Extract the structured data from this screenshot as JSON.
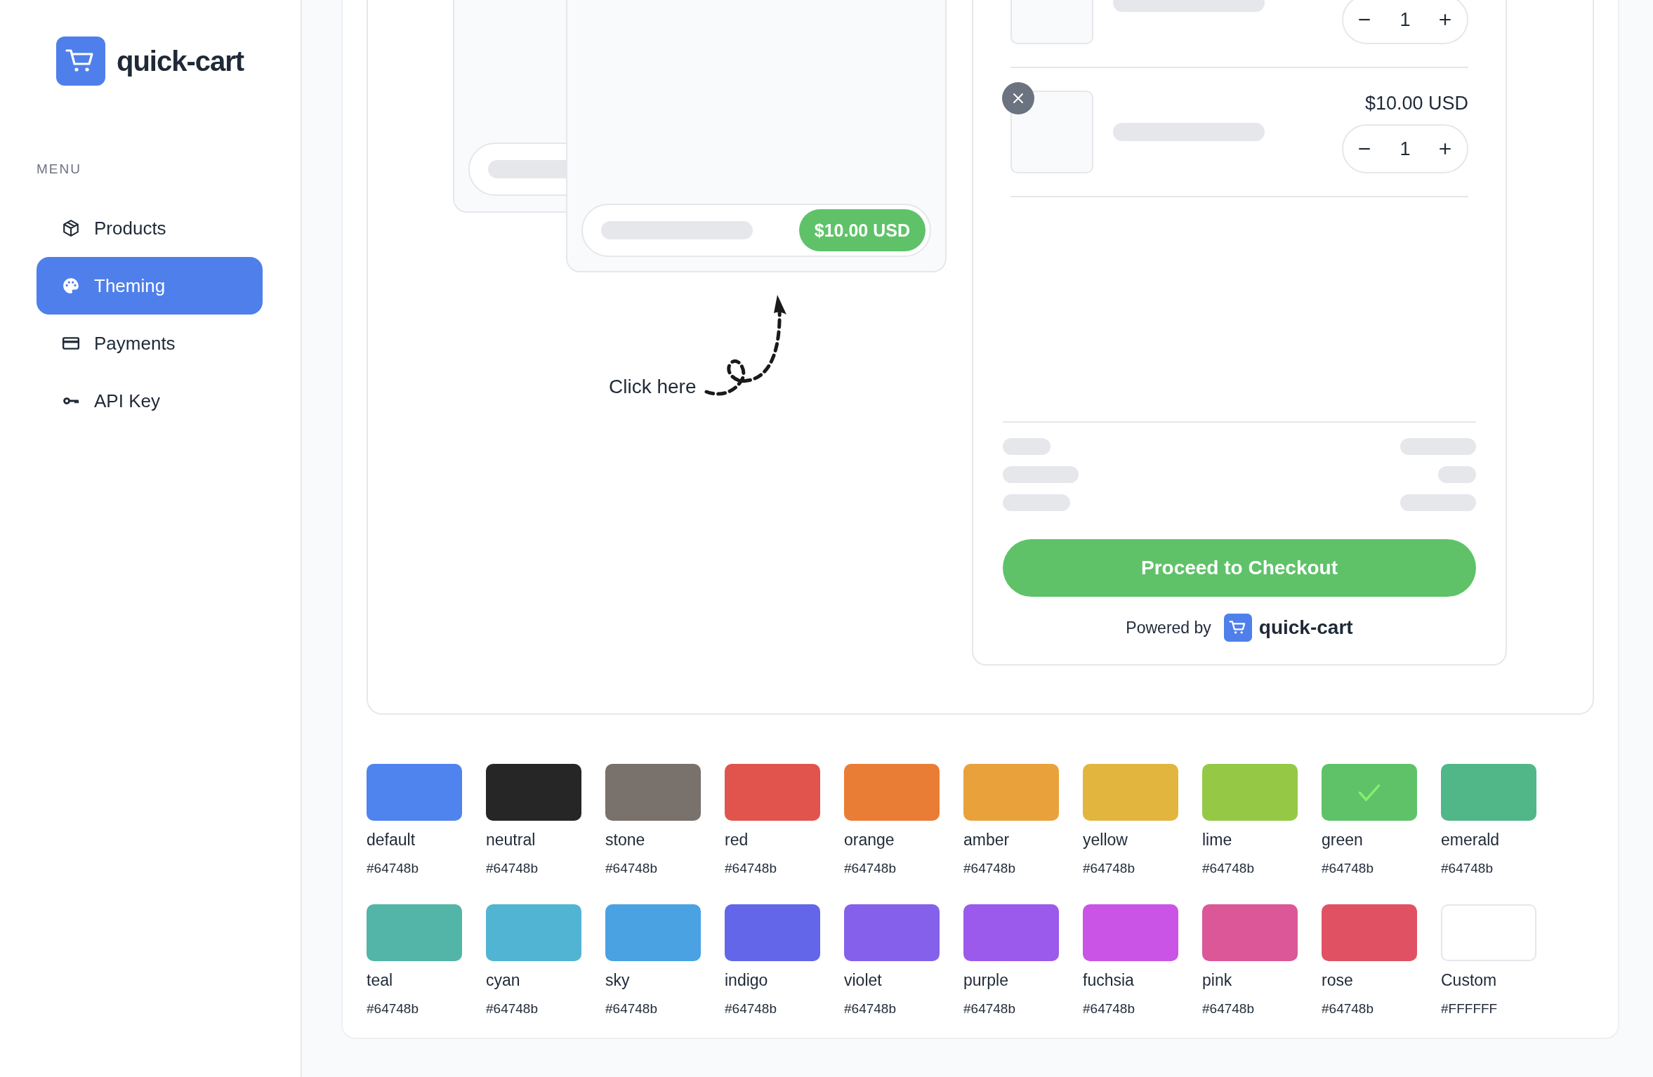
{
  "brand": {
    "name": "quick-cart"
  },
  "menu": {
    "label": "MENU",
    "items": [
      {
        "label": "Products",
        "kind": "box",
        "selected": false
      },
      {
        "label": "Theming",
        "kind": "palette",
        "selected": true
      },
      {
        "label": "Payments",
        "kind": "card",
        "selected": false
      },
      {
        "label": "API Key",
        "kind": "key",
        "selected": false
      }
    ]
  },
  "preview": {
    "product_price": "$10.00 USD",
    "hint": "Click here",
    "cart": {
      "items": [
        {
          "quantity": "1",
          "removable": false
        },
        {
          "price": "$10.00 USD",
          "quantity": "1",
          "removable": true
        }
      ],
      "checkout_button": "Proceed to Checkout",
      "powered_by": "Powered by",
      "powered_brand": "quick-cart"
    }
  },
  "swatches": [
    {
      "name": "default",
      "hex": "#64748b",
      "color": "#4f83ee",
      "selected": false
    },
    {
      "name": "neutral",
      "hex": "#64748b",
      "color": "#262626",
      "selected": false
    },
    {
      "name": "stone",
      "hex": "#64748b",
      "color": "#78716c",
      "selected": false
    },
    {
      "name": "red",
      "hex": "#64748b",
      "color": "#e0544d",
      "selected": false
    },
    {
      "name": "orange",
      "hex": "#64748b",
      "color": "#e97d35",
      "selected": false
    },
    {
      "name": "amber",
      "hex": "#64748b",
      "color": "#e9a23b",
      "selected": false
    },
    {
      "name": "yellow",
      "hex": "#64748b",
      "color": "#e2b53e",
      "selected": false
    },
    {
      "name": "lime",
      "hex": "#64748b",
      "color": "#95c945",
      "selected": false
    },
    {
      "name": "green",
      "hex": "#64748b",
      "color": "#5fc269",
      "selected": true
    },
    {
      "name": "emerald",
      "hex": "#64748b",
      "color": "#52b788",
      "selected": false
    },
    {
      "name": "teal",
      "hex": "#64748b",
      "color": "#52b5a8",
      "selected": false
    },
    {
      "name": "cyan",
      "hex": "#64748b",
      "color": "#52b4d3",
      "selected": false
    },
    {
      "name": "sky",
      "hex": "#64748b",
      "color": "#4aa2e3",
      "selected": false
    },
    {
      "name": "indigo",
      "hex": "#64748b",
      "color": "#6366e9",
      "selected": false
    },
    {
      "name": "violet",
      "hex": "#64748b",
      "color": "#8560ea",
      "selected": false
    },
    {
      "name": "purple",
      "hex": "#64748b",
      "color": "#9b5aeb",
      "selected": false
    },
    {
      "name": "fuchsia",
      "hex": "#64748b",
      "color": "#c954e6",
      "selected": false
    },
    {
      "name": "pink",
      "hex": "#64748b",
      "color": "#db5797",
      "selected": false
    },
    {
      "name": "rose",
      "hex": "#64748b",
      "color": "#e05263",
      "selected": false
    },
    {
      "name": "Custom",
      "hex": "#FFFFFF",
      "color": "#ffffff",
      "selected": false
    }
  ]
}
